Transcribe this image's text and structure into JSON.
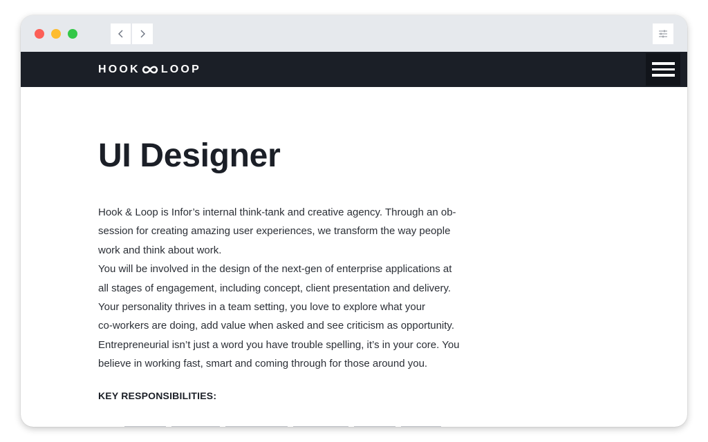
{
  "browser": {
    "back_icon": "chevron-left-icon",
    "forward_icon": "chevron-right-icon",
    "settings_icon": "sliders-icon",
    "traffic_lights": [
      "#fc5f57",
      "#fdbc2e",
      "#33c748"
    ]
  },
  "header": {
    "logo_left": "HOOK",
    "logo_right": "LOOP",
    "logo_symbol": "infinity-icon",
    "menu_icon": "hamburger-icon",
    "background": "#1b1f27"
  },
  "page": {
    "title": "UI Designer",
    "paragraph_lines": [
      "Hook & Loop is Infor’s internal think-tank and creative agency. Through an ob-",
      "session for creating amazing user experiences, we transform the way people",
      "work and think about work.",
      "You will be involved in the design of the next-gen of enterprise applications at",
      "all stages of engagement, including concept, client presentation and delivery.",
      "Your personality thrives in a team setting, you love to explore what your",
      "co-workers are doing, add value when asked and see criticism as opportunity.",
      "Entrepreneurial isn’t just a word you have trouble spelling, it’s in your core. You",
      "believe in working fast, smart and coming through for those around you."
    ],
    "section_heading": "KEY RESPONSIBILITIES:"
  }
}
